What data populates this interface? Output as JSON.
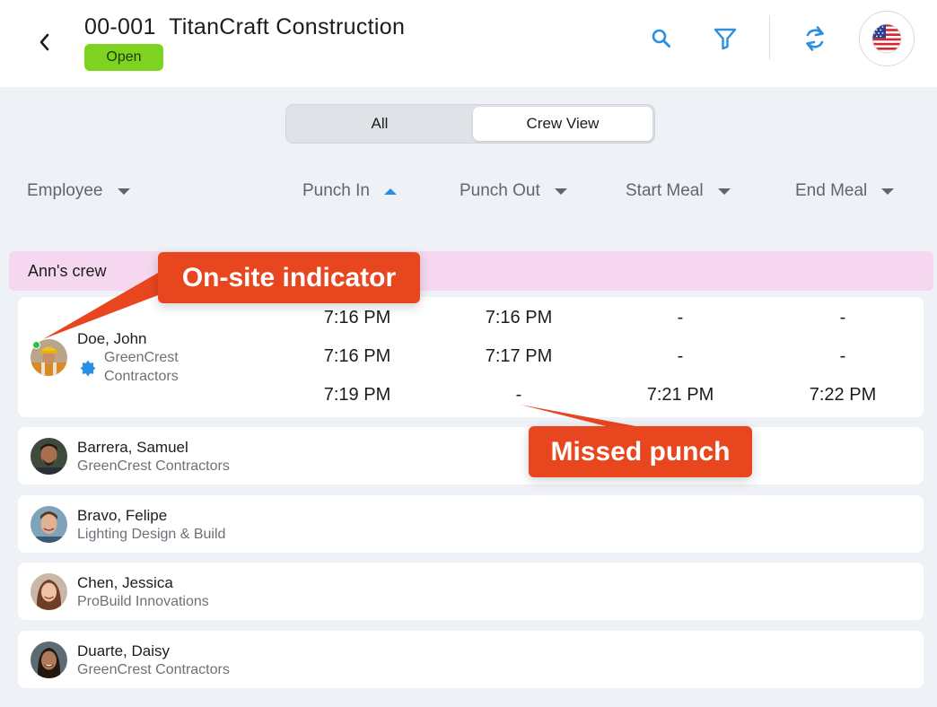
{
  "header": {
    "job_number": "00-001",
    "job_name": "TitanCraft Construction",
    "status": "Open",
    "icons": [
      "back-chevron-icon",
      "search-icon",
      "filter-icon",
      "sync-icon",
      "us-flag-icon"
    ],
    "accent_color": "#2a8fe0",
    "status_color": "#7ed321"
  },
  "view_toggle": {
    "options": [
      "All",
      "Crew View"
    ],
    "selected": "Crew View"
  },
  "columns": [
    {
      "label": "Employee",
      "sort": "none"
    },
    {
      "label": "Punch In",
      "sort": "ascending"
    },
    {
      "label": "Punch Out",
      "sort": "none"
    },
    {
      "label": "Start Meal",
      "sort": "none"
    },
    {
      "label": "End Meal",
      "sort": "none"
    }
  ],
  "crew": {
    "name": "Ann's crew",
    "banner_color": "#f5d8ef"
  },
  "employees": [
    {
      "name": "Doe, John",
      "company": "GreenCrest Contractors",
      "company_line1": "GreenCrest",
      "company_line2": "Contractors",
      "on_site": true,
      "punches": [
        {
          "punch_in": "7:16 PM",
          "punch_out": "7:16 PM",
          "start_meal": "-",
          "end_meal": "-"
        },
        {
          "punch_in": "7:16 PM",
          "punch_out": "7:17 PM",
          "start_meal": "-",
          "end_meal": "-"
        },
        {
          "punch_in": "7:19 PM",
          "punch_out": "-",
          "start_meal": "7:21 PM",
          "end_meal": "7:22 PM"
        }
      ]
    },
    {
      "name": "Barrera, Samuel",
      "company": "GreenCrest Contractors"
    },
    {
      "name": "Bravo, Felipe",
      "company": "Lighting Design & Build"
    },
    {
      "name": "Chen, Jessica",
      "company": "ProBuild Innovations"
    },
    {
      "name": "Duarte, Daisy",
      "company": "GreenCrest Contractors"
    }
  ],
  "annotations": {
    "onsite": "On-site indicator",
    "missed": "Missed punch",
    "color": "#e8461f"
  }
}
